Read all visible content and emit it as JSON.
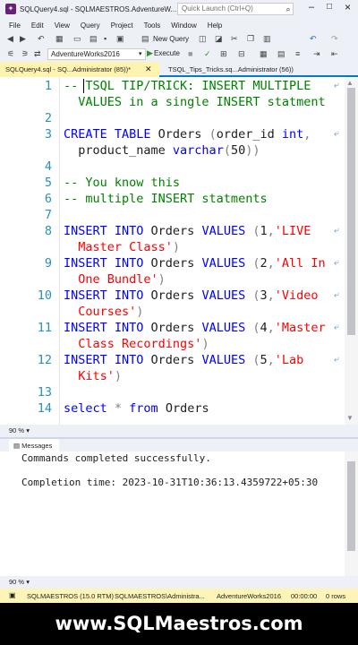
{
  "window": {
    "title": "SQLQuery4.sql - SQLMAESTROS.AdventureW...",
    "quick_launch_placeholder": "Quick Launch (Ctrl+Q)"
  },
  "menu": [
    "File",
    "Edit",
    "View",
    "Query",
    "Project",
    "Tools",
    "Window",
    "Help"
  ],
  "toolbar": {
    "new_query_label": "New Query",
    "database": "AdventureWorks2016",
    "execute_label": "Execute"
  },
  "tabs": {
    "active": "SQLQuery4.sql - SQ...Administrator (85))*",
    "inactive": "TSQL_Tips_Tricks.sq...Administrator (56))"
  },
  "editor": {
    "lines": [
      {
        "n": "1",
        "segments": [
          {
            "t": "-- TSQL TIP/TRICK: INSERT MULTIPLE",
            "c": "cmt"
          }
        ],
        "wrap": true
      },
      {
        "n": "",
        "segments": [
          {
            "t": "  VALUES in a single INSERT statment",
            "c": "cmt"
          }
        ]
      },
      {
        "n": "2",
        "segments": []
      },
      {
        "n": "3",
        "segments": [
          {
            "t": "CREATE TABLE ",
            "c": "kw"
          },
          {
            "t": "Orders ",
            "c": ""
          },
          {
            "t": "(",
            "c": "gray"
          },
          {
            "t": "order_id ",
            "c": ""
          },
          {
            "t": "int",
            "c": "kw"
          },
          {
            "t": ",",
            "c": "gray"
          }
        ],
        "wrap": true
      },
      {
        "n": "",
        "segments": [
          {
            "t": "  product_name ",
            "c": ""
          },
          {
            "t": "varchar",
            "c": "kw"
          },
          {
            "t": "(",
            "c": "gray"
          },
          {
            "t": "50",
            "c": ""
          },
          {
            "t": "))",
            "c": "gray"
          }
        ]
      },
      {
        "n": "4",
        "segments": []
      },
      {
        "n": "5",
        "segments": [
          {
            "t": "-- You know this",
            "c": "cmt"
          }
        ]
      },
      {
        "n": "6",
        "segments": [
          {
            "t": "-- multiple INSERT statments",
            "c": "cmt"
          }
        ]
      },
      {
        "n": "7",
        "segments": []
      },
      {
        "n": "8",
        "segments": [
          {
            "t": "INSERT INTO ",
            "c": "kw"
          },
          {
            "t": "Orders ",
            "c": ""
          },
          {
            "t": "VALUES ",
            "c": "kw"
          },
          {
            "t": "(",
            "c": "gray"
          },
          {
            "t": "1",
            "c": ""
          },
          {
            "t": ",",
            "c": "gray"
          },
          {
            "t": "'LIVE",
            "c": "str"
          }
        ],
        "wrap": true
      },
      {
        "n": "",
        "segments": [
          {
            "t": "  Master Class'",
            "c": "str"
          },
          {
            "t": ")",
            "c": "gray"
          }
        ]
      },
      {
        "n": "9",
        "segments": [
          {
            "t": "INSERT INTO ",
            "c": "kw"
          },
          {
            "t": "Orders ",
            "c": ""
          },
          {
            "t": "VALUES ",
            "c": "kw"
          },
          {
            "t": "(",
            "c": "gray"
          },
          {
            "t": "2",
            "c": ""
          },
          {
            "t": ",",
            "c": "gray"
          },
          {
            "t": "'All In",
            "c": "str"
          }
        ],
        "wrap": true
      },
      {
        "n": "",
        "segments": [
          {
            "t": "  One Bundle'",
            "c": "str"
          },
          {
            "t": ")",
            "c": "gray"
          }
        ]
      },
      {
        "n": "10",
        "segments": [
          {
            "t": "INSERT INTO ",
            "c": "kw"
          },
          {
            "t": "Orders ",
            "c": ""
          },
          {
            "t": "VALUES ",
            "c": "kw"
          },
          {
            "t": "(",
            "c": "gray"
          },
          {
            "t": "3",
            "c": ""
          },
          {
            "t": ",",
            "c": "gray"
          },
          {
            "t": "'Video",
            "c": "str"
          }
        ],
        "wrap": true
      },
      {
        "n": "",
        "segments": [
          {
            "t": "  Courses'",
            "c": "str"
          },
          {
            "t": ")",
            "c": "gray"
          }
        ]
      },
      {
        "n": "11",
        "segments": [
          {
            "t": "INSERT INTO ",
            "c": "kw"
          },
          {
            "t": "Orders ",
            "c": ""
          },
          {
            "t": "VALUES ",
            "c": "kw"
          },
          {
            "t": "(",
            "c": "gray"
          },
          {
            "t": "4",
            "c": ""
          },
          {
            "t": ",",
            "c": "gray"
          },
          {
            "t": "'Master",
            "c": "str"
          }
        ],
        "wrap": true
      },
      {
        "n": "",
        "segments": [
          {
            "t": "  Class Recordings'",
            "c": "str"
          },
          {
            "t": ")",
            "c": "gray"
          }
        ]
      },
      {
        "n": "12",
        "segments": [
          {
            "t": "INSERT INTO ",
            "c": "kw"
          },
          {
            "t": "Orders ",
            "c": ""
          },
          {
            "t": "VALUES ",
            "c": "kw"
          },
          {
            "t": "(",
            "c": "gray"
          },
          {
            "t": "5",
            "c": ""
          },
          {
            "t": ",",
            "c": "gray"
          },
          {
            "t": "'Lab",
            "c": "str"
          }
        ],
        "wrap": true
      },
      {
        "n": "",
        "segments": [
          {
            "t": "  Kits'",
            "c": "str"
          },
          {
            "t": ")",
            "c": "gray"
          }
        ]
      },
      {
        "n": "13",
        "segments": []
      },
      {
        "n": "14",
        "segments": [
          {
            "t": "select ",
            "c": "kw"
          },
          {
            "t": "* ",
            "c": "gray"
          },
          {
            "t": "from ",
            "c": "kw"
          },
          {
            "t": "Orders",
            "c": ""
          }
        ]
      }
    ]
  },
  "zoom": {
    "editor": "90 %",
    "results": "90 %"
  },
  "results": {
    "tab_label": "Messages",
    "messages": [
      "Commands completed successfully.",
      "",
      "Completion time: 2023-10-31T10:36:13.4359722+05:30"
    ]
  },
  "status": {
    "server": "SQLMAESTROS (15.0 RTM)",
    "user": "SQLMAESTROS\\Administra...",
    "database": "AdventureWorks2016",
    "elapsed": "00:00:00",
    "rows": "0 rows"
  },
  "footer": "www.SQLMaestros.com",
  "colors": {
    "keyword": "#0000ff",
    "string": "#ff0000",
    "comment": "#008000",
    "line_number": "#2b91af"
  }
}
